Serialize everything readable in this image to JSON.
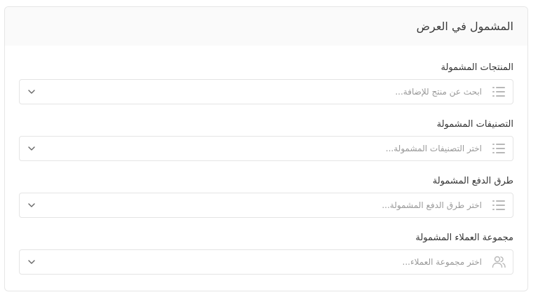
{
  "section": {
    "title": "المشمول في العرض"
  },
  "fields": [
    {
      "label": "المنتجات المشمولة",
      "placeholder": "ابحث عن منتج للإضافة...",
      "icon": "list-icon"
    },
    {
      "label": "التصنيفات المشمولة",
      "placeholder": "اختر التصنيفات المشمولة...",
      "icon": "list-icon"
    },
    {
      "label": "طرق الدفع المشمولة",
      "placeholder": "اختر طرق الدفع المشمولة...",
      "icon": "list-icon"
    },
    {
      "label": "مجموعة العملاء المشمولة",
      "placeholder": "اختر مجموعة العملاء...",
      "icon": "users-icon"
    }
  ],
  "colors": {
    "border": "#e4e4e4",
    "header_bg": "#fafafa",
    "placeholder": "#9a9a9a",
    "icon": "#b8b8b8"
  }
}
